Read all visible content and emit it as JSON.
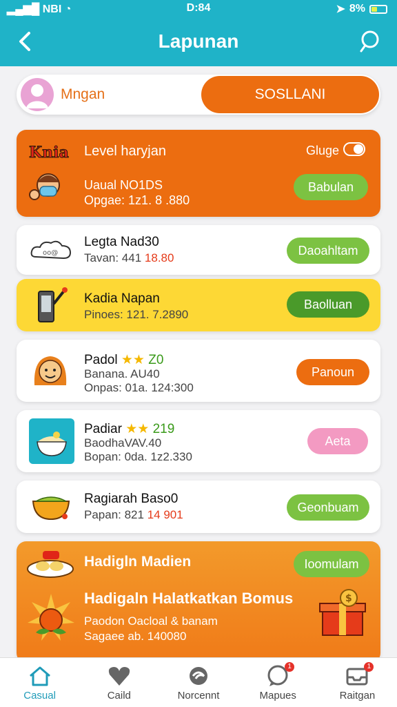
{
  "status": {
    "signal": "NBI",
    "time": "D:84",
    "battery_text": "8%"
  },
  "appbar": {
    "title": "Lapunan"
  },
  "segment": {
    "left_label": "Mngan",
    "right_label": "SOSLLANI"
  },
  "level_card": {
    "brand": "Knia",
    "title": "Level haryjan",
    "toggle_label": "Gluge",
    "line1": "Uaual NO1DS",
    "line2": "Opgae: 1z1. 8 .880",
    "button": "Babulan"
  },
  "items": [
    {
      "name": "Legta Nad30",
      "line1_text": "Tavan: 441",
      "line1_accent": "18.80",
      "button": "Daoahltam",
      "btn_color": "#7cc242"
    },
    {
      "name": "Kadia Napan",
      "line1_text": "Pinoes: 121. 7.2890",
      "button": "Baolluan",
      "btn_color": "#4a9a2a"
    },
    {
      "name": "Padol",
      "stars": "★★",
      "rating": "Z0",
      "line1_text": "Banana. AU40",
      "line2_text": "Onpas: 01a. 124:300",
      "button": "Panoun",
      "btn_color": "#ec6d10"
    },
    {
      "name": "Padiar",
      "stars": "★★",
      "rating": "219",
      "line1_text": "BaodhaVAV.40",
      "line2_text": "Bopan: 0da. 1z2.330",
      "button": "Aeta",
      "btn_color": "#f39ac2"
    },
    {
      "name": "Ragiarah Baso0",
      "line1_text": "Papan: 821",
      "line1_accent": "14 901",
      "button": "Geonbuam",
      "btn_color": "#7cc242"
    }
  ],
  "bonus_card": {
    "title": "Hadigln Madien",
    "button": "Ioomulam",
    "headline": "Hadigaln Halatkatkan Bomus",
    "line1": "Paodon Oacloal & banam",
    "line2": "Sagaee ab. 140080"
  },
  "nav": [
    {
      "label": "Casual",
      "icon": "home-icon",
      "active": true
    },
    {
      "label": "Caild",
      "icon": "heart-icon"
    },
    {
      "label": "Norcennt",
      "icon": "swirl-icon"
    },
    {
      "label": "Mapues",
      "icon": "chat-icon",
      "badge": "1"
    },
    {
      "label": "Raitgan",
      "icon": "inbox-icon",
      "badge": "1"
    }
  ],
  "colors": {
    "primary": "#1fb3c8",
    "orange": "#ec6d10",
    "yellow_card": "#fdd835",
    "green": "#7cc242"
  }
}
